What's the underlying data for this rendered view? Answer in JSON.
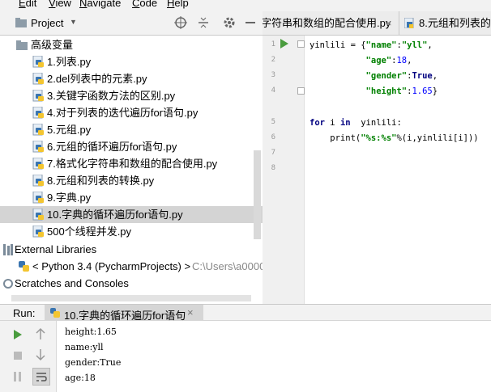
{
  "menu": [
    {
      "label": "Edit",
      "u": "E",
      "rest": "dit"
    },
    {
      "label": "View",
      "u": "V",
      "rest": "iew"
    },
    {
      "label": "Navigate",
      "u": "N",
      "rest": "avigate"
    },
    {
      "label": "Code",
      "u": "C",
      "rest": "ode"
    },
    {
      "label": "Help",
      "u": "H",
      "rest": "elp"
    }
  ],
  "project": {
    "title": "Project"
  },
  "tabs": [
    {
      "label": "字符串和数组的配合使用.py"
    },
    {
      "label": "8.元组和列表的转"
    }
  ],
  "tree": {
    "folder": "高级变量",
    "files": [
      "1.列表.py",
      "2.del列表中的元素.py",
      "3.关键字函数方法的区别.py",
      "4.对于列表的迭代遍历for语句.py",
      "5.元组.py",
      "6.元组的循环遍历for语句.py",
      "7.格式化字符串和数组的配合使用.py",
      "8.元组和列表的转换.py",
      "9.字典.py",
      "10.字典的循环遍历for语句.py",
      "500个线程并发.py"
    ],
    "selected_index": 9,
    "external_libraries": "External Libraries",
    "python_sdk": "< Python 3.4 (PycharmProjects) >",
    "python_path": "C:\\Users\\a0000",
    "scratches": "Scratches and Consoles"
  },
  "editor": {
    "line_numbers": [
      "1",
      "2",
      "3",
      "4",
      "5",
      "6",
      "7",
      "8"
    ]
  },
  "run": {
    "label": "Run:",
    "tab_title": "10.字典的循环遍历for语句",
    "close": "×",
    "output": [
      "height:1.65",
      "name:yll",
      "gender:True",
      "age:18"
    ]
  },
  "colors": {
    "accent": "#4a9c3e",
    "selection": "#d4d4d4",
    "string": "#008000",
    "keyword": "#000080"
  }
}
